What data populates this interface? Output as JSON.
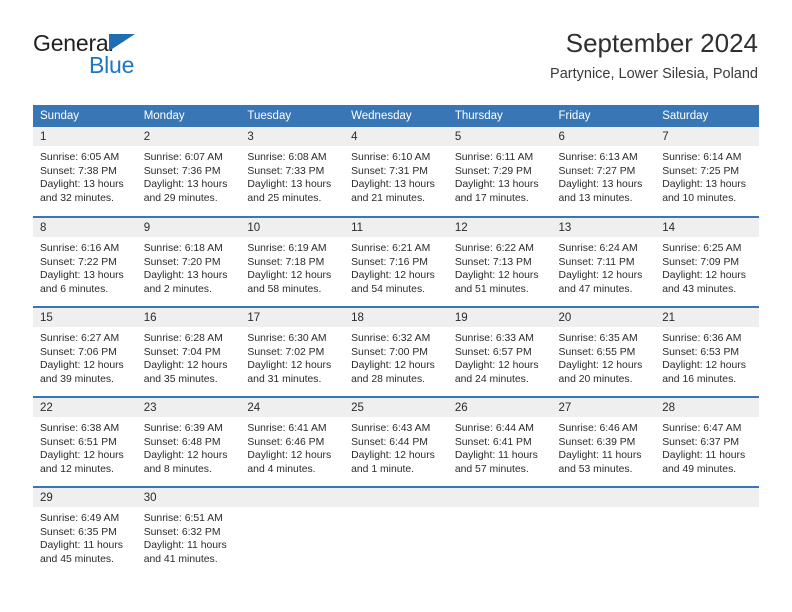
{
  "brand": {
    "name_top": "General",
    "name_bottom": "Blue",
    "accent_color": "#1c77c3",
    "triangle_color": "#1f6db5"
  },
  "header": {
    "title": "September 2024",
    "subtitle": "Partynice, Lower Silesia, Poland"
  },
  "calendar": {
    "header_bg": "#3876b5",
    "daynum_bg": "#efefef",
    "weekday_headers": [
      "Sunday",
      "Monday",
      "Tuesday",
      "Wednesday",
      "Thursday",
      "Friday",
      "Saturday"
    ],
    "weeks": [
      [
        {
          "day": "1",
          "sunrise": "Sunrise: 6:05 AM",
          "sunset": "Sunset: 7:38 PM",
          "daylight_1": "Daylight: 13 hours",
          "daylight_2": "and 32 minutes."
        },
        {
          "day": "2",
          "sunrise": "Sunrise: 6:07 AM",
          "sunset": "Sunset: 7:36 PM",
          "daylight_1": "Daylight: 13 hours",
          "daylight_2": "and 29 minutes."
        },
        {
          "day": "3",
          "sunrise": "Sunrise: 6:08 AM",
          "sunset": "Sunset: 7:33 PM",
          "daylight_1": "Daylight: 13 hours",
          "daylight_2": "and 25 minutes."
        },
        {
          "day": "4",
          "sunrise": "Sunrise: 6:10 AM",
          "sunset": "Sunset: 7:31 PM",
          "daylight_1": "Daylight: 13 hours",
          "daylight_2": "and 21 minutes."
        },
        {
          "day": "5",
          "sunrise": "Sunrise: 6:11 AM",
          "sunset": "Sunset: 7:29 PM",
          "daylight_1": "Daylight: 13 hours",
          "daylight_2": "and 17 minutes."
        },
        {
          "day": "6",
          "sunrise": "Sunrise: 6:13 AM",
          "sunset": "Sunset: 7:27 PM",
          "daylight_1": "Daylight: 13 hours",
          "daylight_2": "and 13 minutes."
        },
        {
          "day": "7",
          "sunrise": "Sunrise: 6:14 AM",
          "sunset": "Sunset: 7:25 PM",
          "daylight_1": "Daylight: 13 hours",
          "daylight_2": "and 10 minutes."
        }
      ],
      [
        {
          "day": "8",
          "sunrise": "Sunrise: 6:16 AM",
          "sunset": "Sunset: 7:22 PM",
          "daylight_1": "Daylight: 13 hours",
          "daylight_2": "and 6 minutes."
        },
        {
          "day": "9",
          "sunrise": "Sunrise: 6:18 AM",
          "sunset": "Sunset: 7:20 PM",
          "daylight_1": "Daylight: 13 hours",
          "daylight_2": "and 2 minutes."
        },
        {
          "day": "10",
          "sunrise": "Sunrise: 6:19 AM",
          "sunset": "Sunset: 7:18 PM",
          "daylight_1": "Daylight: 12 hours",
          "daylight_2": "and 58 minutes."
        },
        {
          "day": "11",
          "sunrise": "Sunrise: 6:21 AM",
          "sunset": "Sunset: 7:16 PM",
          "daylight_1": "Daylight: 12 hours",
          "daylight_2": "and 54 minutes."
        },
        {
          "day": "12",
          "sunrise": "Sunrise: 6:22 AM",
          "sunset": "Sunset: 7:13 PM",
          "daylight_1": "Daylight: 12 hours",
          "daylight_2": "and 51 minutes."
        },
        {
          "day": "13",
          "sunrise": "Sunrise: 6:24 AM",
          "sunset": "Sunset: 7:11 PM",
          "daylight_1": "Daylight: 12 hours",
          "daylight_2": "and 47 minutes."
        },
        {
          "day": "14",
          "sunrise": "Sunrise: 6:25 AM",
          "sunset": "Sunset: 7:09 PM",
          "daylight_1": "Daylight: 12 hours",
          "daylight_2": "and 43 minutes."
        }
      ],
      [
        {
          "day": "15",
          "sunrise": "Sunrise: 6:27 AM",
          "sunset": "Sunset: 7:06 PM",
          "daylight_1": "Daylight: 12 hours",
          "daylight_2": "and 39 minutes."
        },
        {
          "day": "16",
          "sunrise": "Sunrise: 6:28 AM",
          "sunset": "Sunset: 7:04 PM",
          "daylight_1": "Daylight: 12 hours",
          "daylight_2": "and 35 minutes."
        },
        {
          "day": "17",
          "sunrise": "Sunrise: 6:30 AM",
          "sunset": "Sunset: 7:02 PM",
          "daylight_1": "Daylight: 12 hours",
          "daylight_2": "and 31 minutes."
        },
        {
          "day": "18",
          "sunrise": "Sunrise: 6:32 AM",
          "sunset": "Sunset: 7:00 PM",
          "daylight_1": "Daylight: 12 hours",
          "daylight_2": "and 28 minutes."
        },
        {
          "day": "19",
          "sunrise": "Sunrise: 6:33 AM",
          "sunset": "Sunset: 6:57 PM",
          "daylight_1": "Daylight: 12 hours",
          "daylight_2": "and 24 minutes."
        },
        {
          "day": "20",
          "sunrise": "Sunrise: 6:35 AM",
          "sunset": "Sunset: 6:55 PM",
          "daylight_1": "Daylight: 12 hours",
          "daylight_2": "and 20 minutes."
        },
        {
          "day": "21",
          "sunrise": "Sunrise: 6:36 AM",
          "sunset": "Sunset: 6:53 PM",
          "daylight_1": "Daylight: 12 hours",
          "daylight_2": "and 16 minutes."
        }
      ],
      [
        {
          "day": "22",
          "sunrise": "Sunrise: 6:38 AM",
          "sunset": "Sunset: 6:51 PM",
          "daylight_1": "Daylight: 12 hours",
          "daylight_2": "and 12 minutes."
        },
        {
          "day": "23",
          "sunrise": "Sunrise: 6:39 AM",
          "sunset": "Sunset: 6:48 PM",
          "daylight_1": "Daylight: 12 hours",
          "daylight_2": "and 8 minutes."
        },
        {
          "day": "24",
          "sunrise": "Sunrise: 6:41 AM",
          "sunset": "Sunset: 6:46 PM",
          "daylight_1": "Daylight: 12 hours",
          "daylight_2": "and 4 minutes."
        },
        {
          "day": "25",
          "sunrise": "Sunrise: 6:43 AM",
          "sunset": "Sunset: 6:44 PM",
          "daylight_1": "Daylight: 12 hours",
          "daylight_2": "and 1 minute."
        },
        {
          "day": "26",
          "sunrise": "Sunrise: 6:44 AM",
          "sunset": "Sunset: 6:41 PM",
          "daylight_1": "Daylight: 11 hours",
          "daylight_2": "and 57 minutes."
        },
        {
          "day": "27",
          "sunrise": "Sunrise: 6:46 AM",
          "sunset": "Sunset: 6:39 PM",
          "daylight_1": "Daylight: 11 hours",
          "daylight_2": "and 53 minutes."
        },
        {
          "day": "28",
          "sunrise": "Sunrise: 6:47 AM",
          "sunset": "Sunset: 6:37 PM",
          "daylight_1": "Daylight: 11 hours",
          "daylight_2": "and 49 minutes."
        }
      ],
      [
        {
          "day": "29",
          "sunrise": "Sunrise: 6:49 AM",
          "sunset": "Sunset: 6:35 PM",
          "daylight_1": "Daylight: 11 hours",
          "daylight_2": "and 45 minutes."
        },
        {
          "day": "30",
          "sunrise": "Sunrise: 6:51 AM",
          "sunset": "Sunset: 6:32 PM",
          "daylight_1": "Daylight: 11 hours",
          "daylight_2": "and 41 minutes."
        },
        {
          "day": "",
          "sunrise": "",
          "sunset": "",
          "daylight_1": "",
          "daylight_2": ""
        },
        {
          "day": "",
          "sunrise": "",
          "sunset": "",
          "daylight_1": "",
          "daylight_2": ""
        },
        {
          "day": "",
          "sunrise": "",
          "sunset": "",
          "daylight_1": "",
          "daylight_2": ""
        },
        {
          "day": "",
          "sunrise": "",
          "sunset": "",
          "daylight_1": "",
          "daylight_2": ""
        },
        {
          "day": "",
          "sunrise": "",
          "sunset": "",
          "daylight_1": "",
          "daylight_2": ""
        }
      ]
    ]
  }
}
